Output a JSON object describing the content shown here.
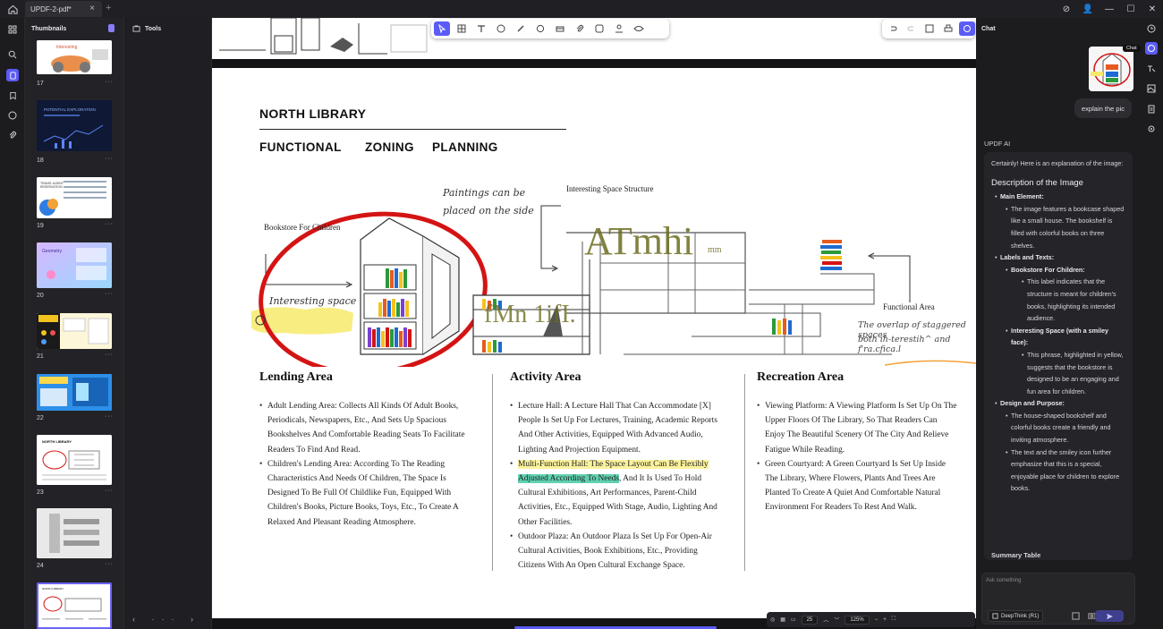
{
  "window": {
    "tab_title": "UPDF-2-pdf*",
    "tab_close": "×",
    "tab_add": "+",
    "controls": [
      "⊘",
      "👤",
      "—",
      "☐",
      "✕"
    ]
  },
  "thumbnails": {
    "title": "Thumbnails",
    "pages": [
      "17",
      "18",
      "19",
      "20",
      "21",
      "22",
      "23",
      "24"
    ],
    "more": "···"
  },
  "tools_panel": {
    "title": "Tools",
    "footer": "‹ ··· ›"
  },
  "document": {
    "title": "NORTH LIBRARY",
    "subtitle": [
      "FUNCTIONAL",
      "ZONING",
      "PLANNING"
    ],
    "illustration": {
      "bookstore_label": "Bookstore For Children",
      "interesting_space": "Interesting space",
      "paintings_note_1": "Paintings can be",
      "paintings_note_2": "placed on the side",
      "space_structure": "Interesting Space Structure",
      "functional_area": "Functional Area",
      "overlap_note_1": "The overlap of staggered spaces",
      "overlap_note_2": "both ih-terestih^ and f'ra.cfica.l",
      "atmhi": "ATmhi",
      "mm": "mm",
      "fmn": "fMn 1ifI."
    },
    "lending": {
      "title": "Lending Area",
      "items": [
        "Adult Lending Area: Collects All Kinds Of Adult Books, Periodicals, Newspapers, Etc., And Sets Up Spacious Bookshelves And Comfortable Reading Seats To Facilitate Readers To Find And Read.",
        "Children's Lending Area: According To The Reading Characteristics And Needs Of Children, The Space Is Designed To Be Full Of Childlike Fun, Equipped With Children's Books, Picture Books, Toys, Etc., To Create A Relaxed And Pleasant Reading Atmosphere."
      ]
    },
    "activity": {
      "title": "Activity Area",
      "item1": "Lecture Hall: A Lecture Hall That Can Accommodate [X] People Is Set Up For Lectures, Training, Academic Reports And Other Activities, Equipped With Advanced Audio, Lighting And Projection Equipment.",
      "item2_hl_yellow": "Multi-Function Hall: The Space Layout Can Be Flexibly",
      "item2_hl_green": "Adjusted According To Needs",
      "item2_rest": ", And It Is Used To Hold Cultural Exhibitions, Art Performances, Parent-Child Activities, Etc., Equipped With Stage, Audio, Lighting And Other Facilities.",
      "item3": "Outdoor Plaza: An Outdoor Plaza Is Set Up For Open-Air Cultural Activities, Book Exhibitions, Etc., Providing Citizens With An Open Cultural Exchange Space."
    },
    "recreation": {
      "title": "Recreation Area",
      "items": [
        "Viewing Platform: A Viewing Platform Is Set Up On The Upper Floors Of The Library, So That Readers Can Enjoy The Beautiful Scenery Of The City And Relieve Fatigue While Reading.",
        "Green Courtyard: A Green Courtyard Is Set Up Inside The Library, Where Flowers, Plants And Trees Are Planted To Create A Quiet And Comfortable Natural Environment For Readers To Rest And Walk."
      ]
    }
  },
  "pagebar": {
    "page": "25",
    "zoom": "125%"
  },
  "chat": {
    "title": "Chat",
    "tooltip": "Chat",
    "user_message": "explain the pic",
    "ai_label": "UPDF AI",
    "ai_intro": "Certainly! Here is an explanation of the image:",
    "ai_heading": "Description of the Image",
    "main_element_label": "Main Element:",
    "main_element_text": "The image features a bookcase shaped like a small house. The bookshelf is filled with colorful books on three shelves.",
    "labels_label": "Labels and Texts:",
    "bookstore_label": "Bookstore For Children:",
    "bookstore_text": "This label indicates that the structure is meant for children's books, highlighting its intended audience.",
    "interesting_label": "Interesting Space (with a smiley face):",
    "interesting_text": "This phrase, highlighted in yellow, suggests that the bookstore is designed to be an engaging and fun area for children.",
    "design_label": "Design and Purpose:",
    "design_text1": "The house-shaped bookshelf and colorful books create a friendly and inviting atmosphere.",
    "design_text2": "The text and the smiley icon further emphasize that this is a special, enjoyable place for children to explore books.",
    "summary": "Summary Table",
    "input_placeholder": "Ask something",
    "model": "DeepThink (R1)"
  },
  "colors": {
    "accent": "#5b5bf6",
    "highlight_yellow": "#fbf29c",
    "highlight_green": "#5fd1b0",
    "ellipse_red": "#d41414"
  }
}
